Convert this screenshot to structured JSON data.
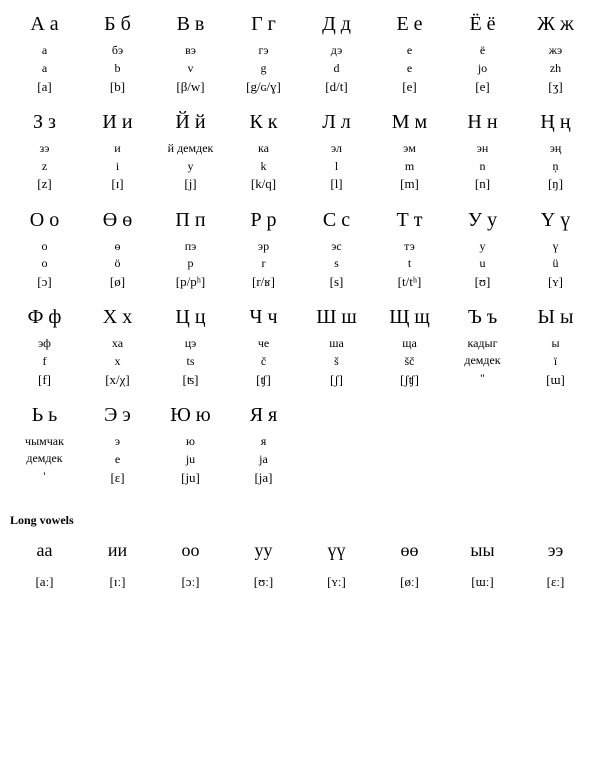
{
  "alphabet": [
    {
      "big": "А а",
      "name": "а",
      "roman": "a",
      "ipa": "[a]"
    },
    {
      "big": "Б б",
      "name": "бэ",
      "roman": "b",
      "ipa": "[b]"
    },
    {
      "big": "В в",
      "name": "вэ",
      "roman": "v",
      "ipa": "[β/w]"
    },
    {
      "big": "Г г",
      "name": "гэ",
      "roman": "g",
      "ipa": "[g/ɢ/ɣ]"
    },
    {
      "big": "Д д",
      "name": "дэ",
      "roman": "d",
      "ipa": "[d/t]"
    },
    {
      "big": "Е е",
      "name": "е",
      "roman": "e",
      "ipa": "[e]"
    },
    {
      "big": "Ё ё",
      "name": "ё",
      "roman": "jo",
      "ipa": "[e]"
    },
    {
      "big": "Ж ж",
      "name": "жэ",
      "roman": "zh",
      "ipa": "[ʒ]"
    },
    {
      "big": "З з",
      "name": "зэ",
      "roman": "z",
      "ipa": "[z]"
    },
    {
      "big": "И и",
      "name": "и",
      "roman": "i",
      "ipa": "[ɪ]"
    },
    {
      "big": "Й й",
      "name": "й демдек",
      "roman": "y",
      "ipa": "[j]"
    },
    {
      "big": "К к",
      "name": "ка",
      "roman": "k",
      "ipa": "[k/q]"
    },
    {
      "big": "Л л",
      "name": "эл",
      "roman": "l",
      "ipa": "[l]"
    },
    {
      "big": "М м",
      "name": "эм",
      "roman": "m",
      "ipa": "[m]"
    },
    {
      "big": "Н н",
      "name": "эн",
      "roman": "n",
      "ipa": "[n]"
    },
    {
      "big": "Ң ң",
      "name": "эң",
      "roman": "ņ",
      "ipa": "[ŋ]"
    },
    {
      "big": "О о",
      "name": "о",
      "roman": "o",
      "ipa": "[ɔ]"
    },
    {
      "big": "Ө ө",
      "name": "ө",
      "roman": "ö",
      "ipa": "[ø]"
    },
    {
      "big": "П п",
      "name": "пэ",
      "roman": "p",
      "ipa": "[p/pʰ]"
    },
    {
      "big": "Р р",
      "name": "эр",
      "roman": "r",
      "ipa": "[r/ʁ]"
    },
    {
      "big": "С с",
      "name": "эс",
      "roman": "s",
      "ipa": "[s]"
    },
    {
      "big": "Т т",
      "name": "тэ",
      "roman": "t",
      "ipa": "[t/tʰ]"
    },
    {
      "big": "У у",
      "name": "у",
      "roman": "u",
      "ipa": "[ʊ]"
    },
    {
      "big": "Ү ү",
      "name": "ү",
      "roman": "ü",
      "ipa": "[ʏ]"
    },
    {
      "big": "Ф ф",
      "name": "эф",
      "roman": "f",
      "ipa": "[f]"
    },
    {
      "big": "Х х",
      "name": "ха",
      "roman": "x",
      "ipa": "[x/χ]"
    },
    {
      "big": "Ц ц",
      "name": "цэ",
      "roman": "ts",
      "ipa": "[ʦ]"
    },
    {
      "big": "Ч ч",
      "name": "че",
      "roman": "č",
      "ipa": "[ʧ]"
    },
    {
      "big": "Ш ш",
      "name": "ша",
      "roman": "š",
      "ipa": "[ʃ]"
    },
    {
      "big": "Щ щ",
      "name": "ща",
      "roman": "šč",
      "ipa": "[ʃʧ]"
    },
    {
      "big": "Ъ ъ",
      "name": "кадыг демдек",
      "roman": "\"",
      "ipa": ""
    },
    {
      "big": "Ы ы",
      "name": "ы",
      "roman": "ï",
      "ipa": "[ɯ]"
    },
    {
      "big": "Ь ь",
      "name": "чымчак демдек",
      "roman": "'",
      "ipa": ""
    },
    {
      "big": "Э э",
      "name": "э",
      "roman": "e",
      "ipa": "[ɛ]"
    },
    {
      "big": "Ю ю",
      "name": "ю",
      "roman": "ju",
      "ipa": "[ju]"
    },
    {
      "big": "Я я",
      "name": "я",
      "roman": "ja",
      "ipa": "[ja]"
    }
  ],
  "long_vowels_title": "Long vowels",
  "long_vowels": [
    {
      "letter": "аа",
      "ipa": "[aː]"
    },
    {
      "letter": "ии",
      "ipa": "[ɪː]"
    },
    {
      "letter": "оо",
      "ipa": "[ɔː]"
    },
    {
      "letter": "уу",
      "ipa": "[ʊː]"
    },
    {
      "letter": "үү",
      "ipa": "[ʏː]"
    },
    {
      "letter": "өө",
      "ipa": "[øː]"
    },
    {
      "letter": "ыы",
      "ipa": "[ɯː]"
    },
    {
      "letter": "ээ",
      "ipa": "[ɛː]"
    }
  ]
}
